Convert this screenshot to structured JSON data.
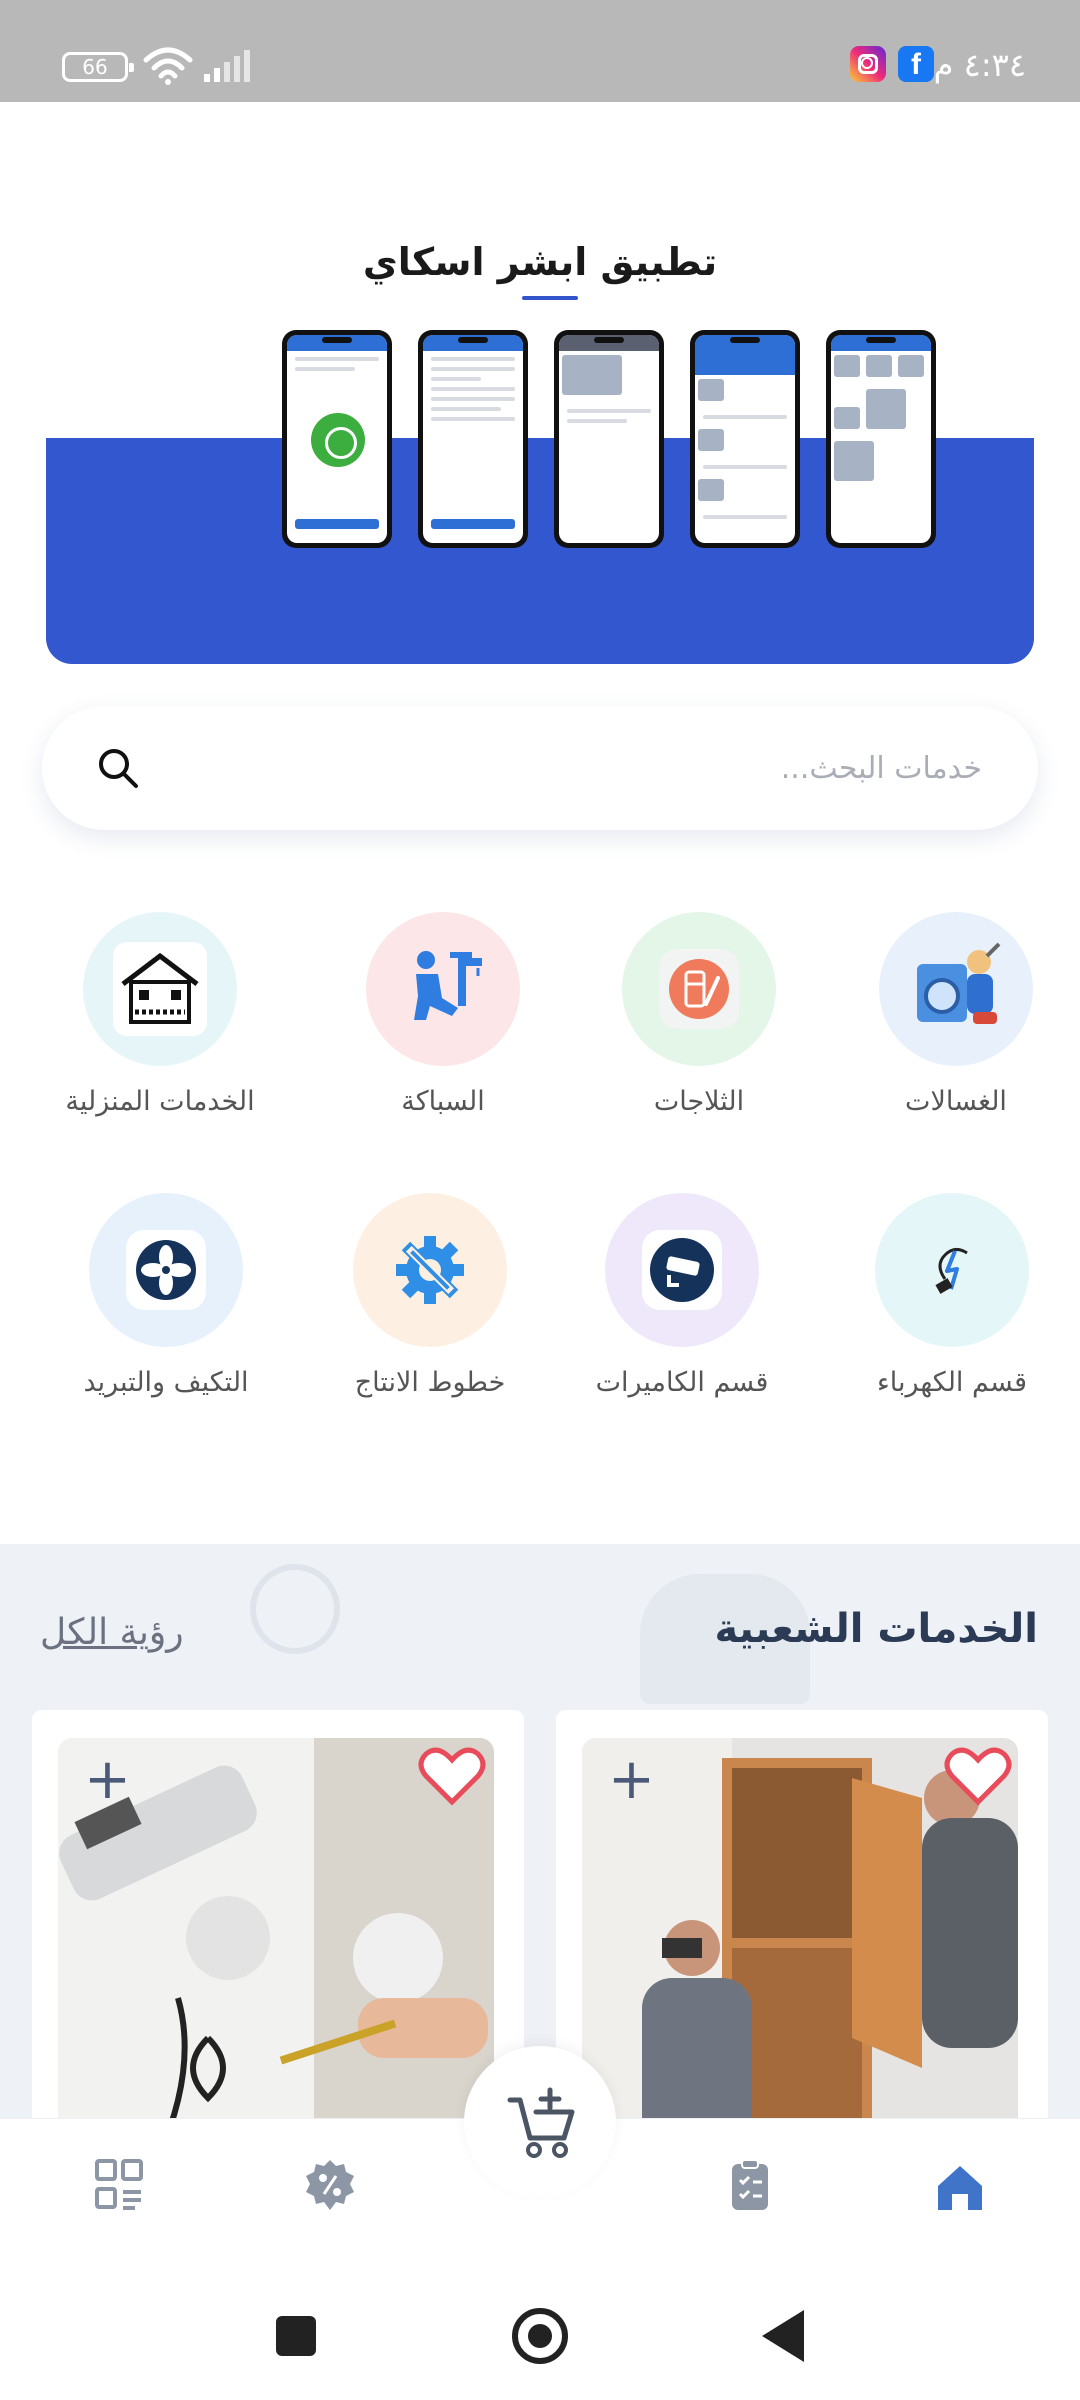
{
  "status_bar": {
    "time": "٤:٣٤ م",
    "battery": "66",
    "notification_icons": [
      "facebook-icon",
      "instagram-icon"
    ],
    "bg_color": "#b8b8b8"
  },
  "banner": {
    "title": "تطبيق ابشر اسكاي",
    "accent_color": "#3357cf"
  },
  "search": {
    "placeholder": "خدمات البحث..."
  },
  "categories": [
    {
      "label": "الغسالات",
      "icon": "washing-machine-technician-icon",
      "bg": "#e8f1fb"
    },
    {
      "label": "الثلاجات",
      "icon": "fridge-repair-icon",
      "bg": "#e3f6e8"
    },
    {
      "label": "السباكة",
      "icon": "plumber-icon",
      "bg": "#fde6e8"
    },
    {
      "label": "الخدمات المنزلية",
      "icon": "home-services-icon",
      "bg": "#e6f6f8"
    },
    {
      "label": "قسم الكهرباء",
      "icon": "electric-bulb-icon",
      "bg": "#e4f6f8"
    },
    {
      "label": "قسم الكاميرات",
      "icon": "security-camera-icon",
      "bg": "#efe8fb"
    },
    {
      "label": "خطوط الانتاج",
      "icon": "gear-wrench-icon",
      "bg": "#fdf0e2"
    },
    {
      "label": "التكيف والتبريد",
      "icon": "fan-icon",
      "bg": "#e6f1fb"
    }
  ],
  "popular": {
    "title": "الخدمات الشعبية",
    "see_all": "رؤية الكل",
    "cards": [
      {
        "image": "cabinet-installation-photo"
      },
      {
        "image": "camera-installation-photo"
      }
    ]
  },
  "bottom_nav": {
    "items": [
      "home-icon",
      "orders-clipboard-icon",
      "cart-add-icon",
      "discount-icon",
      "categories-grid-icon"
    ],
    "active_color": "#3f74c9",
    "inactive_color": "#8d96a4"
  }
}
